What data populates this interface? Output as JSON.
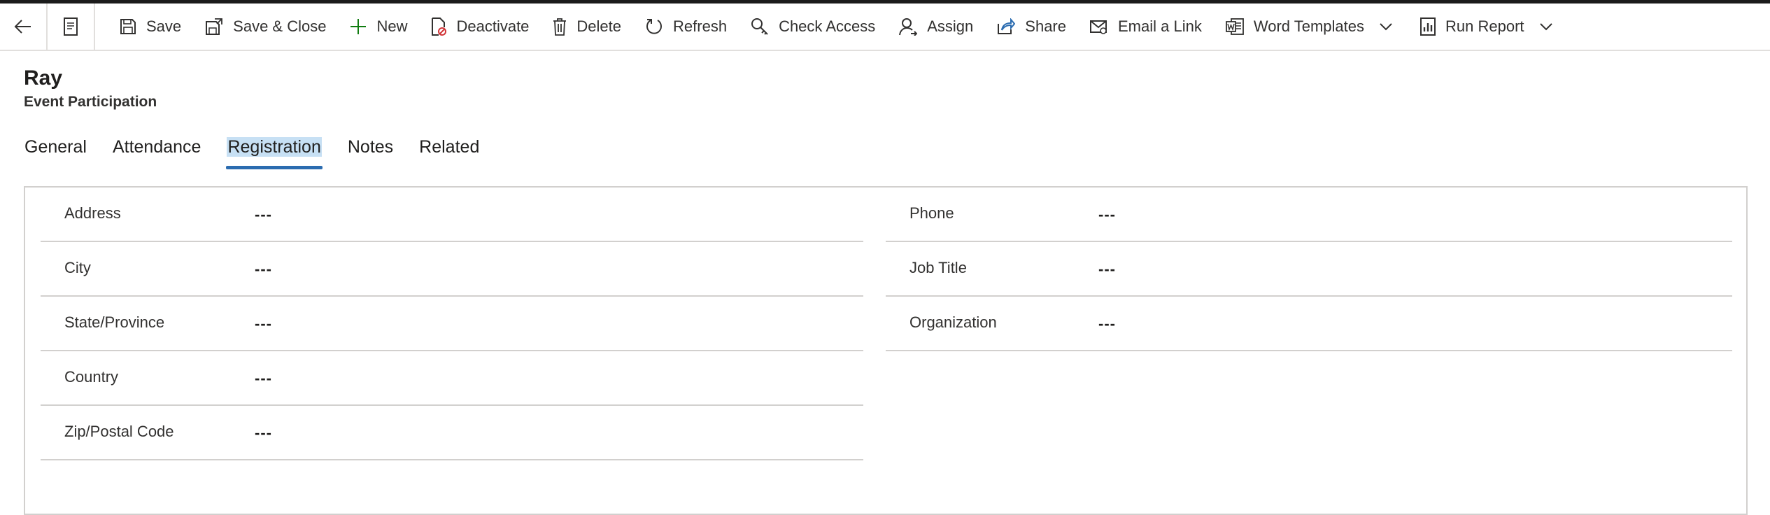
{
  "commandbar": {
    "items": [
      {
        "label": "Save",
        "icon": "save-icon"
      },
      {
        "label": "Save & Close",
        "icon": "save-close-icon"
      },
      {
        "label": "New",
        "icon": "plus-icon"
      },
      {
        "label": "Deactivate",
        "icon": "deactivate-icon"
      },
      {
        "label": "Delete",
        "icon": "trash-icon"
      },
      {
        "label": "Refresh",
        "icon": "refresh-icon"
      },
      {
        "label": "Check Access",
        "icon": "key-icon"
      },
      {
        "label": "Assign",
        "icon": "person-icon"
      },
      {
        "label": "Share",
        "icon": "share-icon"
      },
      {
        "label": "Email a Link",
        "icon": "email-icon"
      },
      {
        "label": "Word Templates",
        "icon": "word-icon"
      },
      {
        "label": "Run Report",
        "icon": "report-icon"
      }
    ],
    "accent_new": "#107c10"
  },
  "record": {
    "title": "Ray",
    "entity": "Event Participation"
  },
  "tabs": [
    {
      "label": "General"
    },
    {
      "label": "Attendance"
    },
    {
      "label": "Registration",
      "active": true
    },
    {
      "label": "Notes"
    },
    {
      "label": "Related"
    }
  ],
  "fields_left": [
    {
      "label": "Address",
      "value": "---"
    },
    {
      "label": "City",
      "value": "---"
    },
    {
      "label": "State/Province",
      "value": "---"
    },
    {
      "label": "Country",
      "value": "---"
    },
    {
      "label": "Zip/Postal Code",
      "value": "---"
    }
  ],
  "fields_right": [
    {
      "label": "Phone",
      "value": "---"
    },
    {
      "label": "Job Title",
      "value": "---"
    },
    {
      "label": "Organization",
      "value": "---"
    }
  ]
}
